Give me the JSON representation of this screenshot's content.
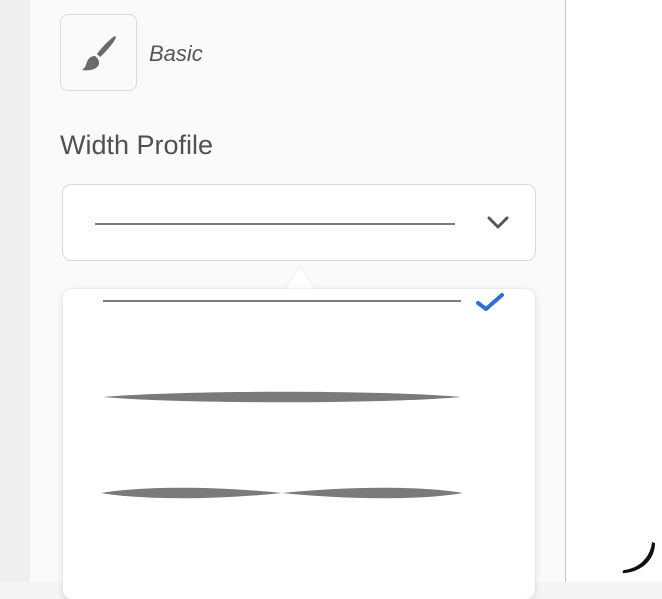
{
  "brush": {
    "name": "Basic",
    "icon": "paintbrush-icon"
  },
  "width_profile": {
    "label": "Width Profile",
    "selected": "uniform",
    "options": [
      {
        "id": "uniform",
        "icon": "uniform-stroke-icon",
        "selected": true
      },
      {
        "id": "tapered-ends",
        "icon": "tapered-stroke-icon",
        "selected": false
      },
      {
        "id": "double-taper",
        "icon": "double-taper-stroke-icon",
        "selected": false
      }
    ]
  },
  "colors": {
    "check": "#2d6fd6",
    "stroke": "#7a7a7a"
  }
}
